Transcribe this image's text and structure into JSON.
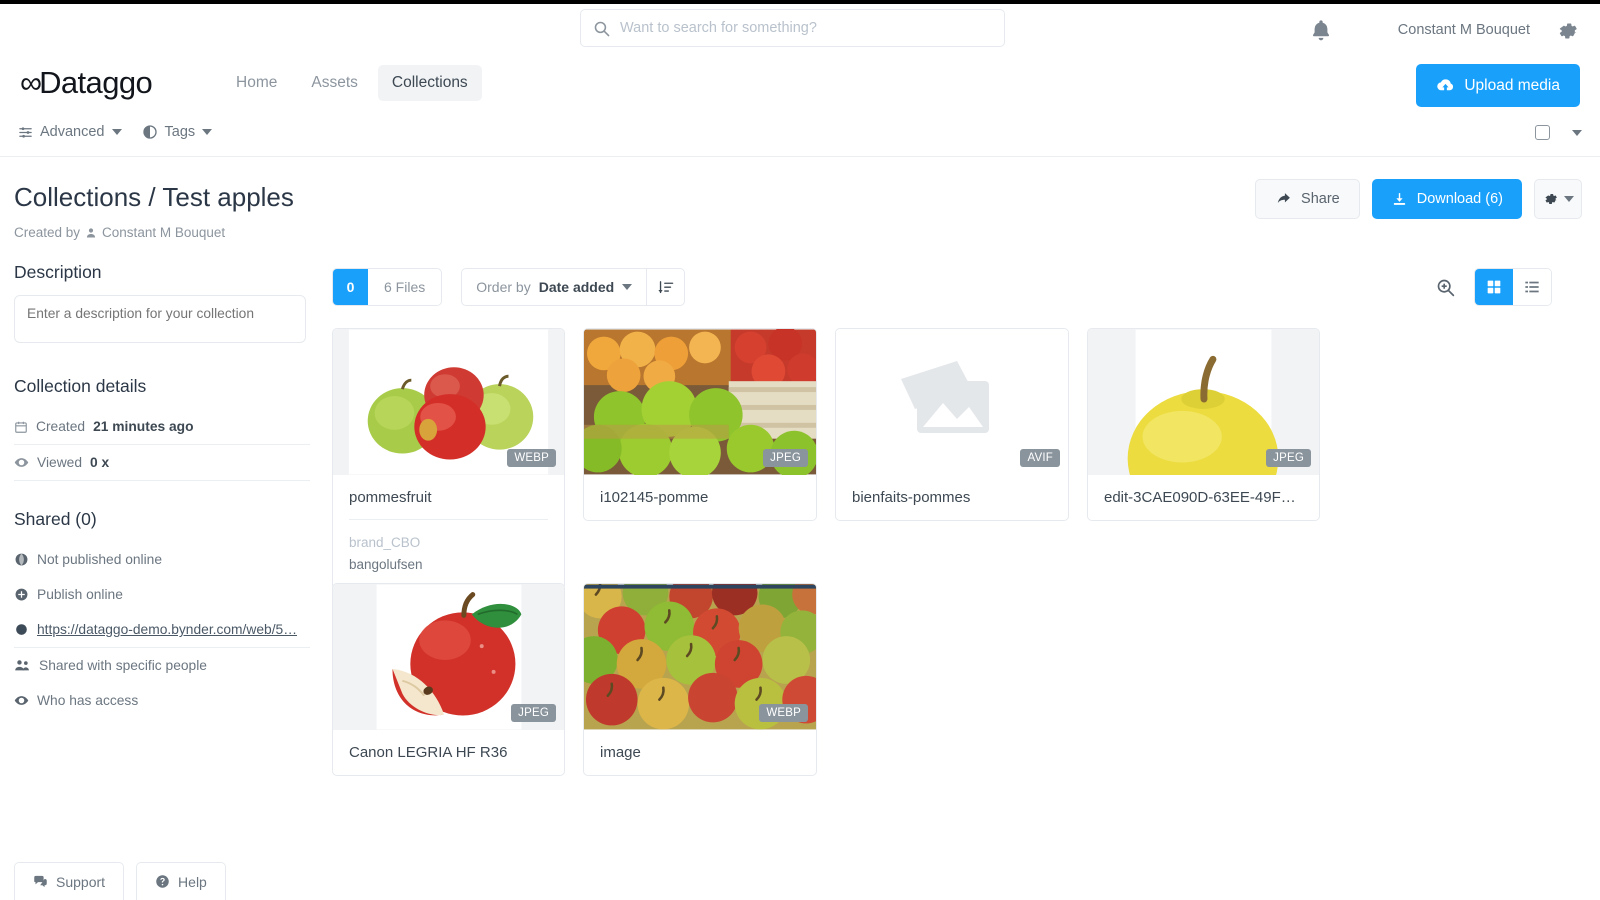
{
  "topbar": {
    "search": {
      "placeholder": "Want to search for something?",
      "value": ""
    },
    "user_name": "Constant M Bouquet",
    "bell_icon": "bell-icon",
    "gear_icon": "gear-icon"
  },
  "nav": {
    "logo": "Dataggo",
    "logo_mark": "∞",
    "links": [
      {
        "label": "Home",
        "active": false
      },
      {
        "label": "Assets",
        "active": false
      },
      {
        "label": "Collections",
        "active": true
      }
    ],
    "upload_label": "Upload media",
    "upload_icon": "cloud-upload-icon"
  },
  "filter_bar": {
    "advanced_label": "Advanced",
    "advanced_icon": "sliders-icon",
    "tags_label": "Tags",
    "tags_icon": "contrast-circle-icon",
    "select_all_icon": "checkbox-icon",
    "more_icon": "chevron-down-icon"
  },
  "header": {
    "breadcrumb": "Collections / Test apples",
    "created_by_label": "Created by",
    "created_by_user": "Constant M Bouquet",
    "created_by_icon": "user-icon",
    "share_label": "Share",
    "share_icon": "share-arrow-icon",
    "download_label": "Download (6)",
    "download_icon": "download-icon",
    "settings_icon": "gear-icon"
  },
  "sidebar": {
    "description_title": "Description",
    "description_placeholder": "Enter a description for your collection",
    "description_value": "",
    "details_title": "Collection details",
    "details": [
      {
        "icon": "calendar-icon",
        "label": "Created",
        "value": "21 minutes ago"
      },
      {
        "icon": "eye-icon",
        "label": "Viewed",
        "value": "0 x"
      }
    ],
    "shared_title": "Shared (0)",
    "shared_rows": [
      {
        "icon": "globe-icon",
        "label": "Not published online",
        "link": false
      },
      {
        "icon": "plus-circle-icon",
        "label": "Publish online",
        "link": false
      },
      {
        "icon": "link-dot-icon",
        "label": "https://dataggo-demo.bynder.com/web/5…",
        "link": true
      },
      {
        "icon": "people-icon",
        "label": "Shared with specific people",
        "link": false
      },
      {
        "icon": "eye-icon",
        "label": "Who has access",
        "link": false
      }
    ]
  },
  "toolbar": {
    "selected_count": "0",
    "files_label": "6 Files",
    "order_prefix": "Order by",
    "order_value": "Date added",
    "sort_icon": "sort-desc-icon",
    "zoom_icon": "magnifier-plus-icon",
    "grid_view_icon": "grid-view-icon",
    "list_view_icon": "list-view-icon",
    "active_view": "grid"
  },
  "assets": [
    {
      "name": "pommesfruit",
      "format": "WEBP",
      "preview": "apples-group",
      "tags": [
        "brand_CBO",
        "bangolufsen"
      ],
      "has_preview": true,
      "letterbox": true
    },
    {
      "name": "i102145-pomme",
      "format": "JPEG",
      "preview": "apple-crates",
      "tags": [],
      "has_preview": true,
      "letterbox": false
    },
    {
      "name": "bienfaits-pommes",
      "format": "AVIF",
      "preview": "no-preview-placeholder",
      "tags": [],
      "has_preview": false,
      "letterbox": false
    },
    {
      "name": "edit-3CAE090D-63EE-49FE…",
      "format": "JPEG",
      "preview": "yellow-apple",
      "tags": [],
      "has_preview": true,
      "letterbox": true
    },
    {
      "name": "Canon LEGRIA HF R36",
      "format": "JPEG",
      "preview": "red-apple-slice",
      "tags": [],
      "has_preview": true,
      "letterbox": true
    },
    {
      "name": "image",
      "format": "WEBP",
      "preview": "apple-pile",
      "tags": [],
      "has_preview": true,
      "letterbox": false
    }
  ],
  "footer": {
    "support_label": "Support",
    "support_icon": "chat-icon",
    "help_label": "Help",
    "help_icon": "question-circle-icon"
  },
  "colors": {
    "accent": "#18a0fb",
    "text": "#3d4852",
    "muted": "#8c959e",
    "border": "#e6eaee",
    "badge": "#8a949c"
  }
}
